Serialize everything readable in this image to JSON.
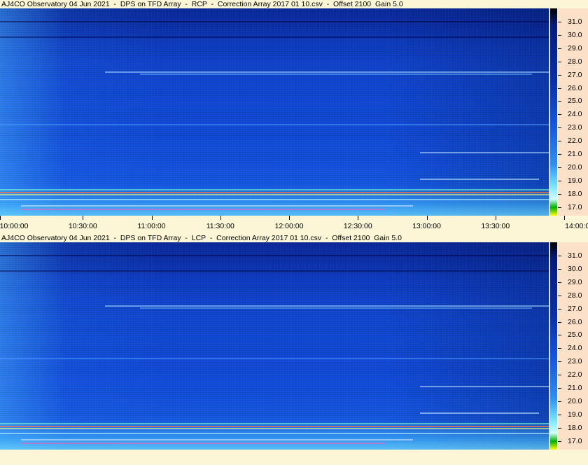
{
  "top_panel": {
    "title": "AJ4CO Observatory 04 Jun 2021  -  DPS on TFD Array  -  RCP  -  Correction Array 2017 01 10.csv  -  Offset 2100  Gain 5.0",
    "freq_ticks": [
      "31.0",
      "30.0",
      "29.0",
      "28.0",
      "27.0",
      "26.0",
      "25.0",
      "24.0",
      "23.0",
      "22.0",
      "21.0",
      "20.0",
      "19.0",
      "18.0",
      "17.0"
    ]
  },
  "time_axis": {
    "labels": [
      "10:00:00",
      "10:30:00",
      "11:00:00",
      "11:30:00",
      "12:00:00",
      "12:30:00",
      "13:00:00",
      "13:30:00",
      "14:00:00"
    ]
  },
  "bottom_panel": {
    "title": "AJ4CO Observatory 04 Jun 2021  -  DPS on TFD Array  -  LCP  -  Correction Array 2017 01 10.csv  -  Offset 2100  Gain 5.0",
    "freq_ticks": [
      "31.0",
      "30.0",
      "29.0",
      "28.0",
      "27.0",
      "26.0",
      "25.0",
      "24.0",
      "23.0",
      "22.0",
      "21.0",
      "20.0",
      "19.0",
      "18.0",
      "17.0"
    ]
  },
  "colors": {
    "background": "#fdf6d6",
    "axis_background": "#fde0c8",
    "spectrogram_base": "#1148d2"
  }
}
